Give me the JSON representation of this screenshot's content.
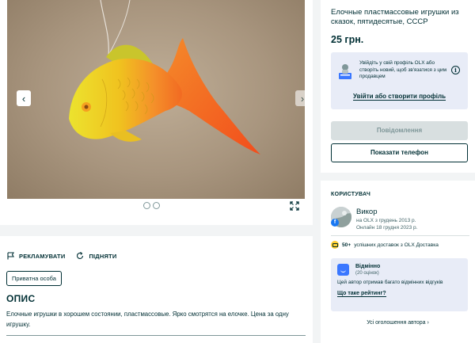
{
  "gallery": {
    "photo_alt": "",
    "dots_count": 2
  },
  "description": {
    "promote_label": "РЕКЛАМУВАТИ",
    "raise_label": "ПІДНЯТИ",
    "seller_type": "Приватна особа",
    "heading": "ОПИС",
    "text": "Елочные игрушки в хорошем состоянии, пластмассовые. Ярко смотрятся на елочке. Цена за одну игрушку."
  },
  "ad": {
    "title": "Елочные пластмассовые игрушки из сказок, пятидесятые, СССР",
    "price": "25 грн.",
    "login_prompt": "Увійдіть у свій профіль OLX або створіть новий, щоб зв'язатися з цим продавцем",
    "info_glyph": "i",
    "login_link": "Увійти або створити профіль",
    "message_button": "Повідомлення",
    "phone_button": "Показати телефон"
  },
  "user": {
    "heading": "КОРИСТУВАЧ",
    "name": "Викор",
    "since": "на OLX з грудень 2013 р.",
    "online": "Онлайн 18 грудня 2023 р.",
    "fb_glyph": "f",
    "delivery_count": "50+",
    "delivery_text": "успішних доставок з OLX Доставка",
    "rating_label": "Відмінно",
    "rating_count": "(20 оцінок)",
    "rating_desc": "Цей автор отримав багато відмінних відгуків",
    "rating_link": "Що таке рейтинг?",
    "all_ads_link": "Усі оголошення автора"
  },
  "colors": {
    "brand_dark": "#002f34",
    "rating_blue": "#3a77ff",
    "delivery_yellow": "#ffce32",
    "fb_blue": "#1877f2"
  }
}
